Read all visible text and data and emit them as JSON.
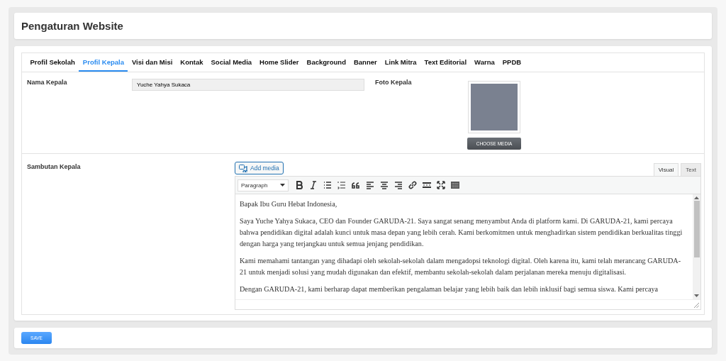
{
  "page_title": "Pengaturan Website",
  "tabs": [
    {
      "label": "Profil Sekolah",
      "selected": false
    },
    {
      "label": "Profil Kepala",
      "selected": true
    },
    {
      "label": "Visi dan Misi",
      "selected": false
    },
    {
      "label": "Kontak",
      "selected": false
    },
    {
      "label": "Social Media",
      "selected": false
    },
    {
      "label": "Home Slider",
      "selected": false
    },
    {
      "label": "Background",
      "selected": false
    },
    {
      "label": "Banner",
      "selected": false
    },
    {
      "label": "Link Mitra",
      "selected": false
    },
    {
      "label": "Text Editorial",
      "selected": false
    },
    {
      "label": "Warna",
      "selected": false
    },
    {
      "label": "PPDB",
      "selected": false
    }
  ],
  "nama_kepala": {
    "label": "Nama Kepala",
    "value": "Yuche Yahya Sukaca"
  },
  "foto_kepala": {
    "label": "Foto Kepala",
    "button": "CHOOSE MEDIA"
  },
  "sambutan": {
    "label": "Sambutan Kepala",
    "add_media": "Add media",
    "editor_tabs": [
      {
        "label": "Visual",
        "selected": true
      },
      {
        "label": "Text",
        "selected": false
      }
    ],
    "format_select": "Paragraph",
    "paragraphs": [
      "Bapak Ibu Guru Hebat Indonesia,",
      "Saya Yuche Yahya Sukaca, CEO dan Founder GARUDA-21. Saya sangat senang menyambut Anda di platform kami. Di GARUDA-21, kami percaya bahwa pendidikan digital adalah kunci untuk masa depan yang lebih cerah. Kami berkomitmen untuk menghadirkan sistem pendidikan berkualitas tinggi dengan harga yang terjangkau untuk semua jenjang pendidikan.",
      "Kami memahami tantangan yang dihadapi oleh sekolah-sekolah dalam mengadopsi teknologi digital. Oleh karena itu, kami telah merancang GARUDA-21 untuk menjadi solusi yang mudah digunakan dan efektif, membantu sekolah-sekolah dalam perjalanan mereka menuju digitalisasi.",
      "Dengan GARUDA-21, kami berharap dapat memberikan pengalaman belajar yang lebih baik dan lebih inklusif bagi semua siswa. Kami percaya"
    ]
  },
  "save_button": "SAVE"
}
